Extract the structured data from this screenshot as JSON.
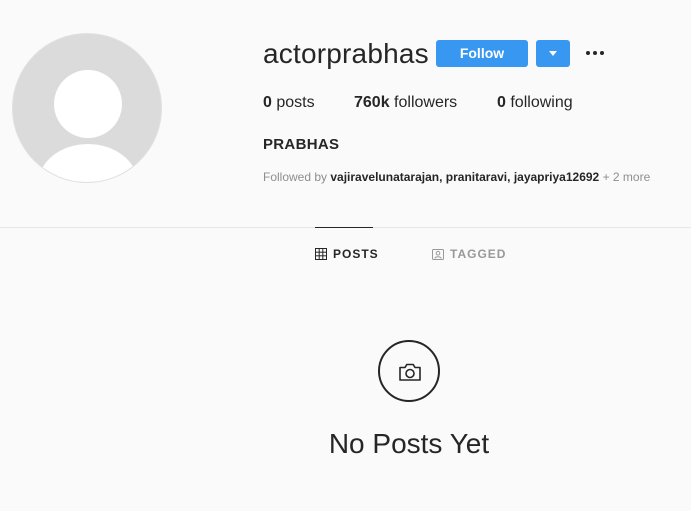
{
  "profile": {
    "username": "actorprabhas",
    "full_name": "PRABHAS",
    "follow_label": "Follow",
    "avatar_icon": "default-avatar-icon"
  },
  "stats": {
    "posts_count": "0",
    "posts_label": "posts",
    "followers_count": "760k",
    "followers_label": "followers",
    "following_count": "0",
    "following_label": "following"
  },
  "followed_by": {
    "prefix": "Followed by",
    "names": [
      "vajiravelunatarajan",
      "pranitaravi",
      "jayapriya12692"
    ],
    "sep1": ", ",
    "sep2": ", ",
    "more": "+ 2 more"
  },
  "tabs": [
    {
      "label": "POSTS",
      "icon": "grid-icon",
      "active": true
    },
    {
      "label": "TAGGED",
      "icon": "tagged-icon",
      "active": false
    }
  ],
  "empty_state": {
    "icon": "camera-icon",
    "message": "No Posts Yet"
  },
  "colors": {
    "accent": "#3897f0",
    "background": "#fafafa",
    "text": "#262626",
    "muted": "#8e8e8e"
  }
}
